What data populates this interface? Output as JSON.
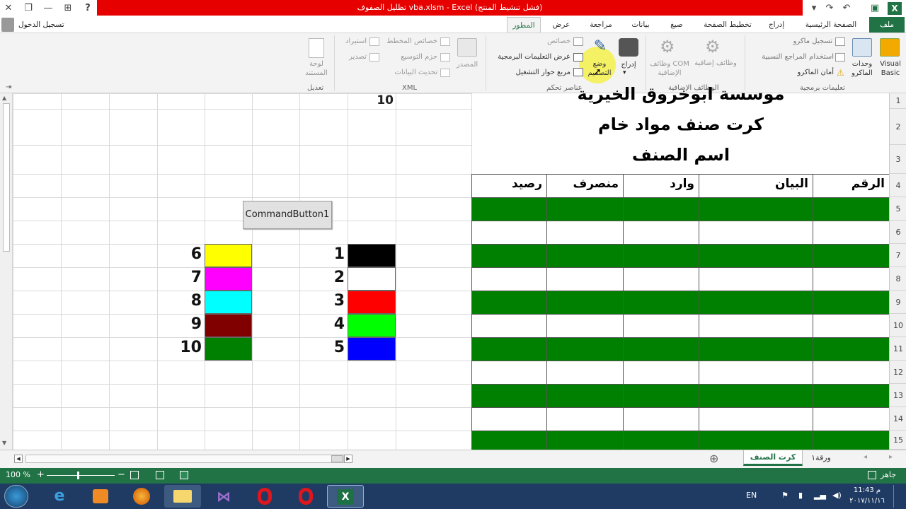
{
  "window": {
    "title": "تظليل الصفوف vba.xlsm - Excel  (فشل تنشيط المنتج)",
    "signin": "تسجيل الدخول",
    "help_glyph": "?",
    "close_glyph": "✕",
    "restore_glyph": "❐",
    "ribbon_opts_glyph": "⊞",
    "min_glyph": "—"
  },
  "tabs": {
    "file": "ملف",
    "home": "الصفحة الرئيسية",
    "insert": "إدراج",
    "page_layout": "تخطيط الصفحة",
    "formulas": "صيغ",
    "data": "بيانات",
    "review": "مراجعة",
    "view": "عرض",
    "developer": "المطور"
  },
  "ribbon": {
    "code": {
      "visual_basic": "Visual Basic",
      "macros": "وحدات الماكرو",
      "record_macro": "تسجيل ماكرو",
      "relative_refs": "استخدام المراجع النسبية",
      "macro_security": "أمان الماكرو",
      "group_label": "تعليمات برمجية"
    },
    "addins": {
      "addins": "وظائف إضافية",
      "com_addins": "وظائف COM الإضافية",
      "group_label": "الوظائف الإضافية"
    },
    "controls": {
      "insert": "إدراج",
      "design_mode": "وضع التصميم",
      "properties": "خصائص",
      "view_code": "عرض التعليمات البرمجية",
      "run_dialog": "مربع حوار التشغيل",
      "group_label": "عناصر تحكم"
    },
    "xml": {
      "source": "المصدر",
      "map_props": "خصائص المخطط",
      "expansion_packs": "حزم التوسيع",
      "refresh_data": "تحديث البيانات",
      "import": "استيراد",
      "export": "تصدير",
      "group_label": "XML"
    },
    "modify": {
      "doc_panel": "لوحة المستند",
      "group_label": "تعديل"
    }
  },
  "sheet": {
    "header_lines": [
      "موسسة ابوخروق الخيرية",
      "كرت صنف مواد خام",
      "اسم الصنف"
    ],
    "table_headers": [
      "الرقم",
      "البيان",
      "وارد",
      "منصرف",
      "رصيد"
    ],
    "value_top": "10",
    "row_numbers": [
      "1",
      "2",
      "3",
      "4",
      "5",
      "6",
      "7",
      "8",
      "9",
      "10",
      "11",
      "12",
      "13",
      "14",
      "15"
    ],
    "color_index_left": [
      {
        "n": "1",
        "color": "#000000"
      },
      {
        "n": "2",
        "color": "#ffffff"
      },
      {
        "n": "3",
        "color": "#ff0000"
      },
      {
        "n": "4",
        "color": "#00ff00"
      },
      {
        "n": "5",
        "color": "#0000ff"
      }
    ],
    "color_index_right": [
      {
        "n": "6",
        "color": "#ffff00"
      },
      {
        "n": "7",
        "color": "#ff00ff"
      },
      {
        "n": "8",
        "color": "#00ffff"
      },
      {
        "n": "9",
        "color": "#800000"
      },
      {
        "n": "10",
        "color": "#008000"
      }
    ],
    "band_color": "#008000",
    "command_button": "CommandButton1"
  },
  "sheet_tabs": {
    "active": "كرت الصنف",
    "other": "ورقة١",
    "add_glyph": "⊕"
  },
  "status": {
    "ready": "جاهز",
    "zoom": "100 %"
  },
  "taskbar": {
    "lang": "EN",
    "time": "11:43 م",
    "date": "٢٠١٧/١١/١٦"
  }
}
